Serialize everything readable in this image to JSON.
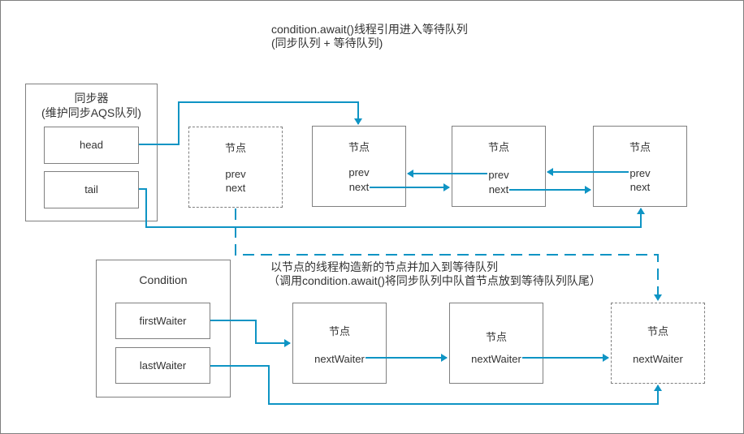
{
  "title": {
    "line1": "condition.await()线程引用进入等待队列",
    "line2": "(同步队列 + 等待队列)"
  },
  "synchronizer": {
    "label_line1": "同步器",
    "label_line2": "(维护同步AQS队列)",
    "head": "head",
    "tail": "tail"
  },
  "sync_queue": {
    "nodes": [
      {
        "label": "节点",
        "prev": "prev",
        "next": "next",
        "style": "dashed"
      },
      {
        "label": "节点",
        "prev": "prev",
        "next": "next",
        "style": "solid"
      },
      {
        "label": "节点",
        "prev": "prev",
        "next": "next",
        "style": "solid"
      },
      {
        "label": "节点",
        "prev": "prev",
        "next": "next",
        "style": "solid"
      }
    ]
  },
  "annotation": {
    "line1": "以节点的线程构造新的节点并加入到等待队列",
    "line2": "（调用condition.await()将同步队列中队首节点放到等待队列队尾）"
  },
  "condition": {
    "label": "Condition",
    "first_waiter": "firstWaiter",
    "last_waiter": "lastWaiter"
  },
  "wait_queue": {
    "nodes": [
      {
        "label": "节点",
        "field": "nextWaiter",
        "style": "solid"
      },
      {
        "label": "节点",
        "field": "nextWaiter",
        "style": "solid"
      },
      {
        "label": "节点",
        "field": "nextWaiter",
        "style": "dashed"
      }
    ]
  },
  "colors": {
    "connector": "#0e94c4",
    "border": "#808080",
    "text": "#333333"
  }
}
